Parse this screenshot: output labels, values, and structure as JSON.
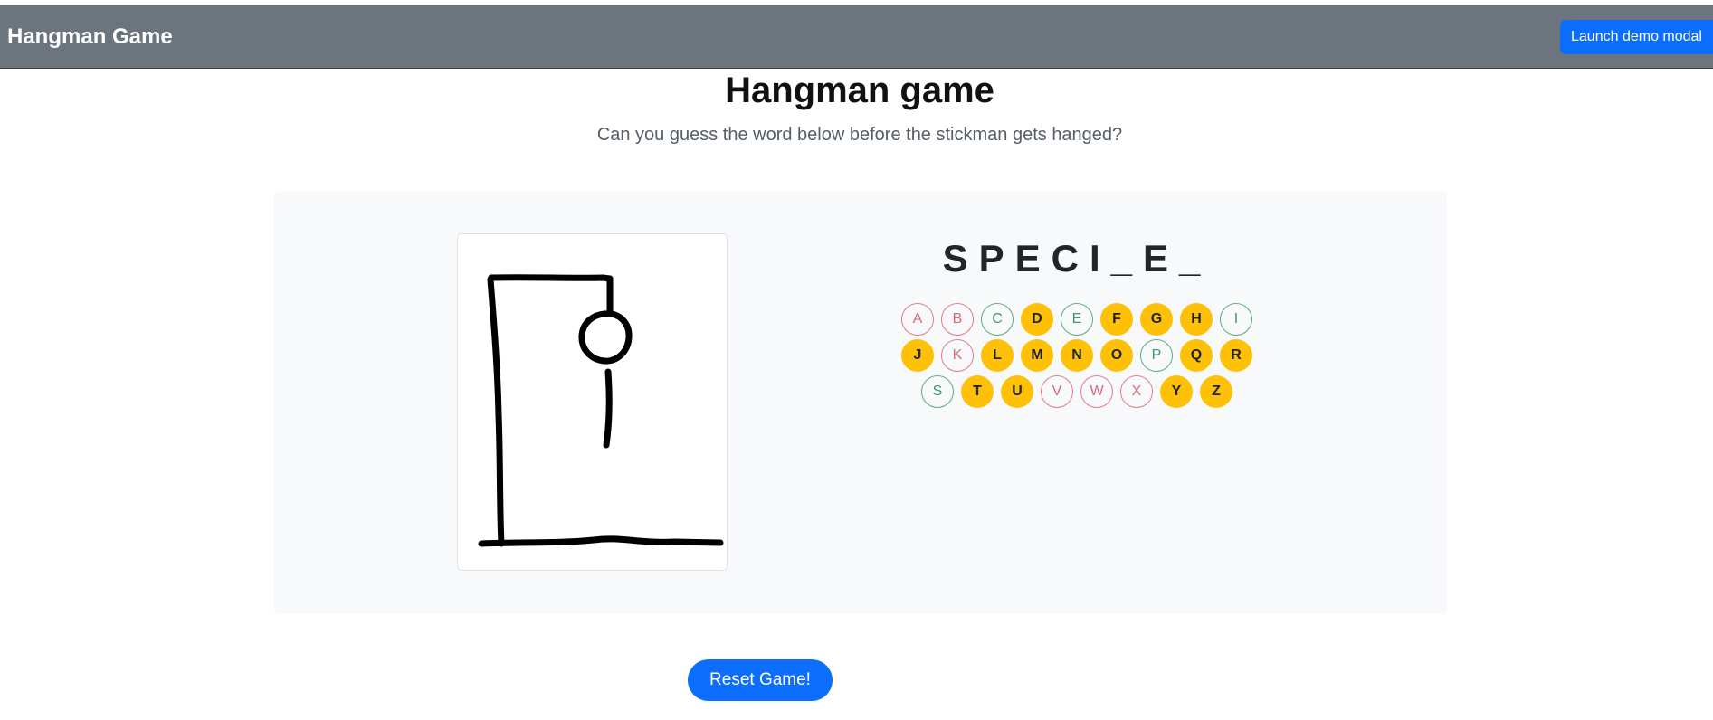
{
  "navbar": {
    "brand": "Hangman Game",
    "modal_button": "Launch demo modal"
  },
  "header": {
    "title": "Hangman game",
    "subtitle": "Can you guess the word below before the stickman gets hanged?"
  },
  "game": {
    "word_display": "SPECI_E_",
    "wrong_guesses": 6,
    "letter_rows": [
      [
        {
          "letter": "A",
          "state": "used-wrong"
        },
        {
          "letter": "B",
          "state": "used-wrong"
        },
        {
          "letter": "C",
          "state": "used-right"
        },
        {
          "letter": "D",
          "state": "available"
        },
        {
          "letter": "E",
          "state": "used-right"
        },
        {
          "letter": "F",
          "state": "available"
        },
        {
          "letter": "G",
          "state": "available"
        },
        {
          "letter": "H",
          "state": "available"
        },
        {
          "letter": "I",
          "state": "used-right"
        }
      ],
      [
        {
          "letter": "J",
          "state": "available"
        },
        {
          "letter": "K",
          "state": "used-wrong"
        },
        {
          "letter": "L",
          "state": "available"
        },
        {
          "letter": "M",
          "state": "available"
        },
        {
          "letter": "N",
          "state": "available"
        },
        {
          "letter": "O",
          "state": "available"
        },
        {
          "letter": "P",
          "state": "used-right"
        },
        {
          "letter": "Q",
          "state": "available"
        },
        {
          "letter": "R",
          "state": "available"
        }
      ],
      [
        {
          "letter": "S",
          "state": "used-right"
        },
        {
          "letter": "T",
          "state": "available"
        },
        {
          "letter": "U",
          "state": "available"
        },
        {
          "letter": "V",
          "state": "used-wrong"
        },
        {
          "letter": "W",
          "state": "used-wrong"
        },
        {
          "letter": "X",
          "state": "used-wrong"
        },
        {
          "letter": "Y",
          "state": "available"
        },
        {
          "letter": "Z",
          "state": "available"
        }
      ]
    ]
  },
  "controls": {
    "reset_label": "Reset Game!"
  },
  "colors": {
    "navbar": "#6c757d",
    "primary": "#0d6efd",
    "available_letter": "#ffc107",
    "wrong_letter": "#dc6a77",
    "right_letter": "#3f9a6c"
  }
}
